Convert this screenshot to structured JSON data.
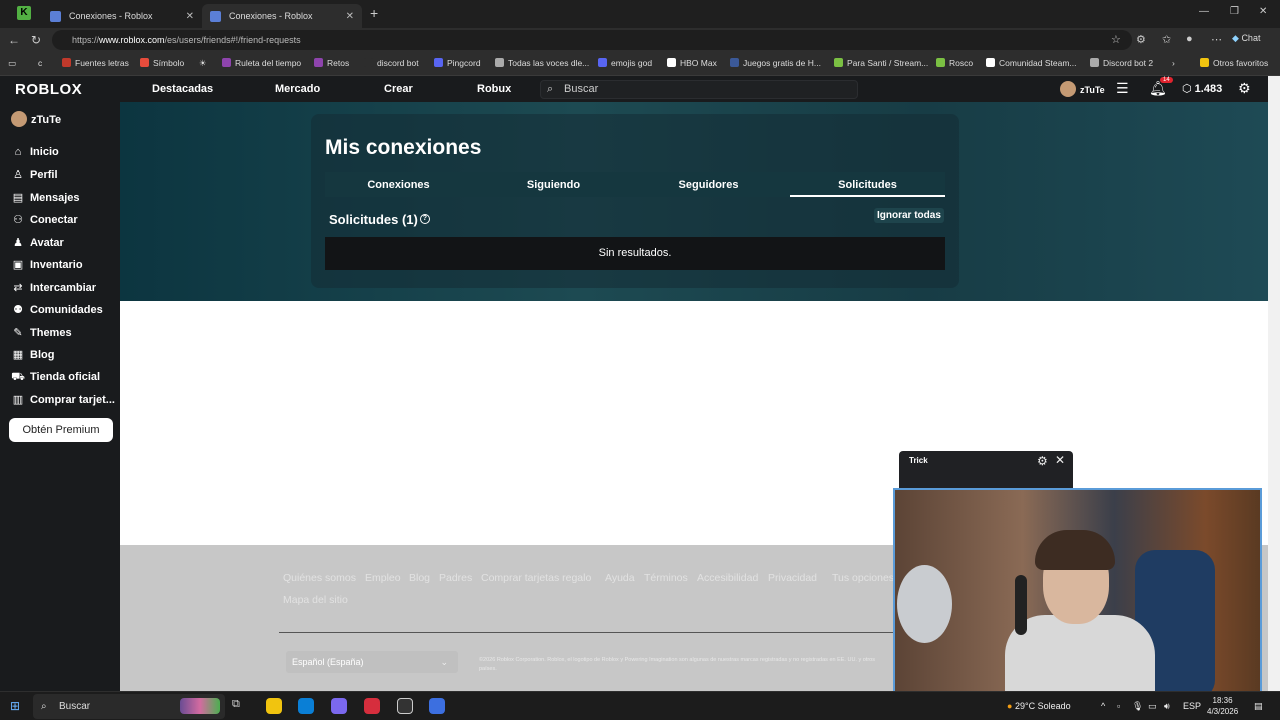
{
  "browser": {
    "tabs": [
      {
        "title": "Conexiones - Roblox"
      },
      {
        "title": "Conexiones - Roblox"
      }
    ],
    "url_prefix": "https://",
    "url_host": "www.roblox.com",
    "url_path": "/es/users/friends#!/friend-requests",
    "chat_label": "Chat",
    "bookmarks": [
      {
        "label": "Fuentes letras",
        "color": "#c0392b"
      },
      {
        "label": "Símbolo",
        "color": "#e74c3c"
      },
      {
        "label": "Ruleta del tiempo",
        "color": "#8e44ad"
      },
      {
        "label": "Retos",
        "color": "#8e44ad"
      },
      {
        "label": "discord bot",
        "color": "#2d2d2d"
      },
      {
        "label": "Pingcord",
        "color": "#5865f2"
      },
      {
        "label": "Todas las voces dle...",
        "color": "#aaaaaa"
      },
      {
        "label": "emojis god",
        "color": "#5865f2"
      },
      {
        "label": "HBO Max",
        "color": "#ffffff"
      },
      {
        "label": "Juegos gratis de H...",
        "color": "#3b5998"
      },
      {
        "label": "Para Santi / Stream...",
        "color": "#7bc043"
      },
      {
        "label": "Rosco",
        "color": "#7bc043"
      },
      {
        "label": "Comunidad Steam...",
        "color": "#ffffff"
      },
      {
        "label": "Discord bot 2",
        "color": "#aaaaaa"
      },
      {
        "label": "Otros favoritos",
        "color": "#f1c40f"
      }
    ]
  },
  "roblox_nav": {
    "logo": "ROBLOX",
    "links": [
      "Destacadas",
      "Mercado",
      "Crear",
      "Robux"
    ],
    "search_placeholder": "Buscar",
    "username": "zTuTe",
    "notifications_count": "14",
    "robux_balance": "1.483"
  },
  "sidebar": {
    "username": "zTuTe",
    "items": [
      {
        "label": "Inicio",
        "icon": "home-icon"
      },
      {
        "label": "Perfil",
        "icon": "profile-icon"
      },
      {
        "label": "Mensajes",
        "icon": "messages-icon"
      },
      {
        "label": "Conectar",
        "icon": "connect-icon"
      },
      {
        "label": "Avatar",
        "icon": "avatar-icon"
      },
      {
        "label": "Inventario",
        "icon": "inventory-icon"
      },
      {
        "label": "Intercambiar",
        "icon": "trade-icon"
      },
      {
        "label": "Comunidades",
        "icon": "communities-icon"
      },
      {
        "label": "Themes",
        "icon": "themes-icon"
      },
      {
        "label": "Blog",
        "icon": "blog-icon"
      },
      {
        "label": "Tienda oficial",
        "icon": "store-icon"
      },
      {
        "label": "Comprar tarjet...",
        "icon": "gift-card-icon"
      }
    ],
    "premium_button": "Obtén Premium"
  },
  "main": {
    "title": "Mis conexiones",
    "tabs": [
      {
        "label": "Conexiones",
        "active": false
      },
      {
        "label": "Siguiendo",
        "active": false
      },
      {
        "label": "Seguidores",
        "active": false
      },
      {
        "label": "Solicitudes",
        "active": true
      }
    ],
    "requests_title": "Solicitudes (1)",
    "ignore_all": "Ignorar todas",
    "empty_message": "Sin resultados."
  },
  "footer": {
    "links": [
      "Quiénes somos",
      "Empleo",
      "Blog",
      "Padres",
      "Comprar tarjetas regalo",
      "Ayuda",
      "Términos",
      "Accesibilidad",
      "Privacidad",
      "Tus opciones"
    ],
    "links_row2": [
      "Mapa del sitio"
    ],
    "language": "Español (España)",
    "copyright": "©2026 Roblox Corporation. Roblox, el logotipo de Roblox y Powering Imagination son algunas de nuestras marcas registradas y no registradas en EE. UU. y otros países."
  },
  "overlay": {
    "title": "Trick"
  },
  "taskbar": {
    "search_placeholder": "Buscar",
    "weather": "29°C  Soleado",
    "language": "ESP",
    "time": "18:36",
    "date": "4/3/2026"
  }
}
